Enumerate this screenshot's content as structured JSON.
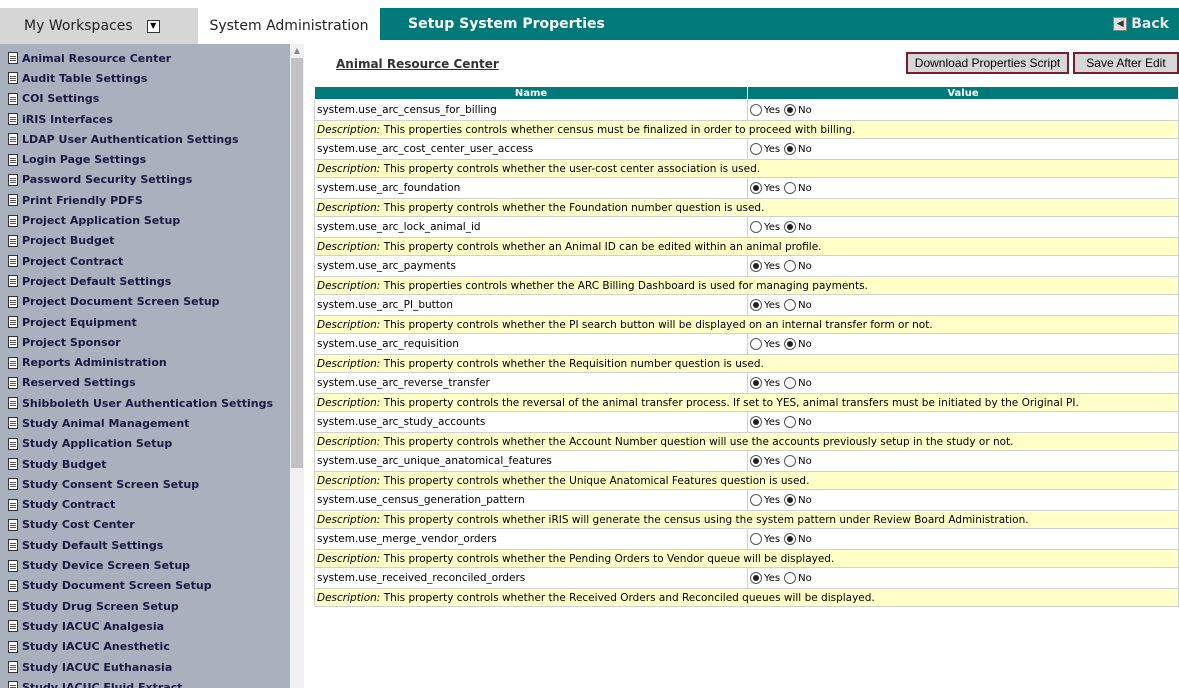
{
  "header": {
    "workspaces_label": "My Workspaces",
    "admin_tab_label": "System Administration",
    "page_title": "Setup System Properties",
    "back_label": "Back"
  },
  "sidebar": {
    "items": [
      "Animal Resource Center",
      "Audit Table Settings",
      "COI Settings",
      "iRIS Interfaces",
      "LDAP User Authentication Settings",
      "Login Page Settings",
      "Password Security Settings",
      "Print Friendly PDFS",
      "Project Application Setup",
      "Project Budget",
      "Project Contract",
      "Project Default Settings",
      "Project Document Screen Setup",
      "Project Equipment",
      "Project Sponsor",
      "Reports Administration",
      "Reserved Settings",
      "Shibboleth User Authentication Settings",
      "Study Animal Management",
      "Study Application Setup",
      "Study Budget",
      "Study Consent Screen Setup",
      "Study Contract",
      "Study Cost Center",
      "Study Default Settings",
      "Study Device Screen Setup",
      "Study Document Screen Setup",
      "Study Drug Screen Setup",
      "Study IACUC Analgesia",
      "Study IACUC Anesthetic",
      "Study IACUC Euthanasia",
      "Study IACUC Fluid Extract"
    ]
  },
  "main": {
    "section_title": "Animal Resource Center",
    "download_button": "Download Properties Script",
    "save_button": "Save After Edit",
    "col_name": "Name",
    "col_value": "Value",
    "yes_label": "Yes",
    "no_label": "No",
    "desc_prefix": "Description:",
    "properties": [
      {
        "name": "system.use_arc_census_for_billing",
        "value": "No",
        "desc": "This properties controls whether census must be finalized in order to proceed with billing."
      },
      {
        "name": "system.use_arc_cost_center_user_access",
        "value": "No",
        "desc": "This property controls whether the user-cost center association is used."
      },
      {
        "name": "system.use_arc_foundation",
        "value": "Yes",
        "desc": "This property controls whether the Foundation number question is used."
      },
      {
        "name": "system.use_arc_lock_animal_id",
        "value": "No",
        "desc": "This property controls whether an Animal ID can be edited within an animal profile."
      },
      {
        "name": "system.use_arc_payments",
        "value": "Yes",
        "desc": "This properties controls whether the ARC Billing Dashboard is used for managing payments."
      },
      {
        "name": "system.use_arc_PI_button",
        "value": "Yes",
        "desc": "This property controls whether the PI search button will be displayed on an internal transfer form or not."
      },
      {
        "name": "system.use_arc_requisition",
        "value": "No",
        "desc": "This property controls whether the Requisition number question is used."
      },
      {
        "name": "system.use_arc_reverse_transfer",
        "value": "Yes",
        "desc": "This property controls the reversal of the animal transfer process. If set to YES, animal transfers must be initiated by the Original PI."
      },
      {
        "name": "system.use_arc_study_accounts",
        "value": "Yes",
        "desc": "This property controls whether the Account Number question will use the accounts previously setup in the study or not."
      },
      {
        "name": "system.use_arc_unique_anatomical_features",
        "value": "Yes",
        "desc": "This property controls whether the Unique Anatomical Features question is used."
      },
      {
        "name": "system.use_census_generation_pattern",
        "value": "No",
        "desc": "This property controls whether iRIS will generate the census using the system pattern under Review Board Administration."
      },
      {
        "name": "system.use_merge_vendor_orders",
        "value": "No",
        "desc": "This property controls whether the Pending Orders to Vendor queue will be displayed."
      },
      {
        "name": "system.use_received_reconciled_orders",
        "value": "Yes",
        "desc": "This property controls whether the Received Orders and Reconciled queues will be displayed."
      }
    ]
  }
}
